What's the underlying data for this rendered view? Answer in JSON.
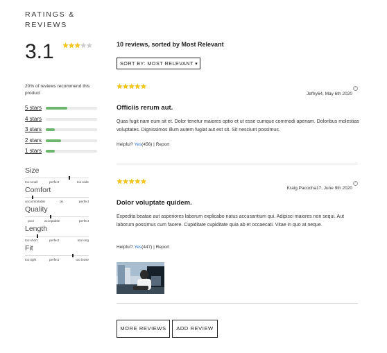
{
  "summary": {
    "title_line1": "RATINGS &",
    "title_line2": "REVIEWS",
    "average": "3.1",
    "average_rating": 3.1,
    "recommend_text": "20% of reviews recommend this product"
  },
  "breakdown": [
    {
      "label": "5 stars",
      "fraction": 0.42
    },
    {
      "label": "4 stars",
      "fraction": 0.0
    },
    {
      "label": "3 stars",
      "fraction": 0.18
    },
    {
      "label": "2 stars",
      "fraction": 0.3
    },
    {
      "label": "1 stars",
      "fraction": 0.18
    }
  ],
  "characteristics": [
    {
      "name": "Size",
      "labels": [
        "too small",
        "perfect",
        "too wide"
      ],
      "value": 0.7
    },
    {
      "name": "Comfort",
      "labels": [
        "uncomfortable",
        "ok",
        "perfect"
      ],
      "value": 0.12
    },
    {
      "name": "Quality",
      "labels": [
        "poor",
        "acceptable",
        "perfect"
      ],
      "value": 0.4
    },
    {
      "name": "Length",
      "labels": [
        "too short",
        "perfect",
        "too long"
      ],
      "value": 0.2
    },
    {
      "name": "Fit",
      "labels": [
        "too tight",
        "perfect",
        "too loose"
      ],
      "value": 0.75
    }
  ],
  "sort": {
    "heading": "10  reviews, sorted by  Most Relevant",
    "select_label": "SORT BY: MOST RELEVANT ▾"
  },
  "reviews": [
    {
      "rating": 5,
      "meta": "Jeffry64,  May 6th 2020",
      "title": "Officiis rerum aut.",
      "body": "Quas fugit nam eum sit et. Dolor tenetur maiores optio et ut esse cumque commodi aperiam. Doloribus molestias voluptates. Dignissimos illum autem fugiat aut est sit. Sit nesciunt possimus.",
      "helpful_prefix": "Helpful?",
      "yes_label": "Yes",
      "yes_count": "(456)",
      "separator": "|",
      "report_label": "Report"
    },
    {
      "rating": 5,
      "meta": "Kraig.Pacocha17,  June 9th 2020",
      "title": "Dolor voluptate quidem.",
      "body": "Expedita beatae aut asperiores laborum explicabo natus accusantium qui. Adipisci maiores non sequi. Aut laborum possimus cum facere. Cupiditate cupiditate quia ab et occaecati. Vitae in quo at neque.",
      "helpful_prefix": "Helpful?",
      "yes_label": "Yes",
      "yes_count": "(447)",
      "separator": "|",
      "report_label": "Report"
    }
  ],
  "buttons": {
    "more_reviews": "MORE REVIEWS",
    "add_review": "ADD REVIEW"
  },
  "colors": {
    "star": "#f5c518",
    "star_empty": "#cccccc",
    "bar_fill": "#6bb56d",
    "link": "#2a6fdb"
  }
}
